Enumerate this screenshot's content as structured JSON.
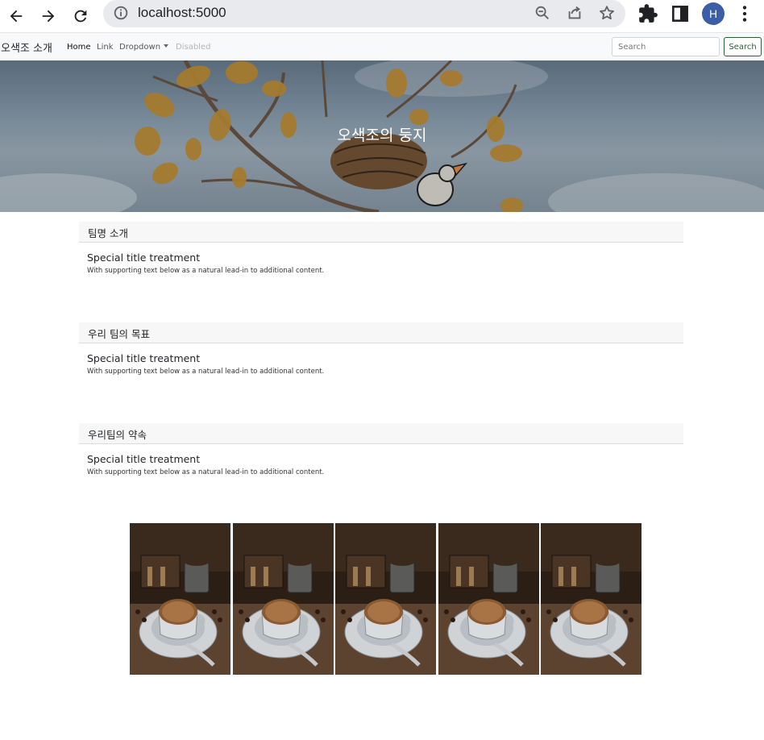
{
  "browser": {
    "url": "localhost:5000",
    "profile_initial": "H",
    "icons": [
      "back-arrow-icon",
      "forward-arrow-icon",
      "reload-icon",
      "info-icon",
      "zoom-out-icon",
      "share-icon",
      "star-icon",
      "extensions-icon",
      "side-panel-icon",
      "more-icon"
    ]
  },
  "navbar": {
    "brand": "오색조 소개",
    "links": [
      {
        "label": "Home"
      },
      {
        "label": "Link"
      },
      {
        "label": "Dropdown"
      },
      {
        "label": "Disabled"
      }
    ],
    "search_placeholder": "Search",
    "search_button": "Search"
  },
  "hero": {
    "title": "오색조의 둥지"
  },
  "cards": [
    {
      "header": "팀명 소개",
      "title": "Special title treatment",
      "text": "With supporting text below as a natural lead-in to additional content."
    },
    {
      "header": "우리 팀의 목표",
      "title": "Special title treatment",
      "text": "With supporting text below as a natural lead-in to additional content."
    },
    {
      "header": "우리팀의 약속",
      "title": "Special title treatment",
      "text": "With supporting text below as a natural lead-in to additional content."
    }
  ],
  "gallery": {
    "count": 5,
    "subject": "coffee-cup-photo"
  },
  "colors": {
    "accent_button": "#2e5d3a",
    "avatar": "#3b5ea6",
    "navbar_bg": "#f8f9fa"
  }
}
